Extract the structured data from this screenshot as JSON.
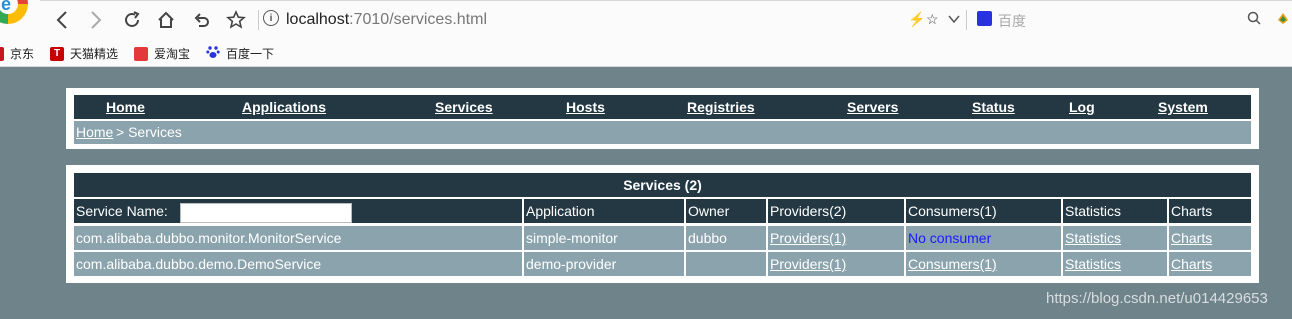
{
  "browser": {
    "url_host": "localhost",
    "url_rest": ":7010/services.html",
    "search_placeholder": "百度"
  },
  "bookmarks": [
    {
      "label": "京东",
      "icon": "jd-icon",
      "color": "#c81623"
    },
    {
      "label": "天猫精选",
      "icon": "tmall-icon",
      "color": "#c40000"
    },
    {
      "label": "爱淘宝",
      "icon": "aitaobao-icon",
      "color": "#e4393c"
    },
    {
      "label": "百度一下",
      "icon": "baidu-paw-icon",
      "color": "#2932e1"
    }
  ],
  "nav": {
    "items": [
      "Home",
      "Applications",
      "Services",
      "Hosts",
      "Registries",
      "Servers",
      "Status",
      "Log",
      "System"
    ]
  },
  "breadcrumb": {
    "home": "Home",
    "rest": "> Services"
  },
  "services": {
    "caption": "Services (2)",
    "search_label": "Service Name:",
    "search_value": "",
    "headers": [
      "Application",
      "Owner",
      "Providers(2)",
      "Consumers(1)",
      "Statistics",
      "Charts"
    ],
    "rows": [
      {
        "service": "com.alibaba.dubbo.monitor.MonitorService",
        "application": "simple-monitor",
        "owner": "dubbo",
        "providers": "Providers(1)",
        "consumers": "No consumer",
        "statistics": "Statistics",
        "charts": "Charts"
      },
      {
        "service": "com.alibaba.dubbo.demo.DemoService",
        "application": "demo-provider",
        "owner": "",
        "providers": "Providers(1)",
        "consumers": "Consumers(1)",
        "statistics": "Statistics",
        "charts": "Charts"
      }
    ]
  },
  "watermark": "https://blog.csdn.net/u014429653",
  "colors": {
    "page_bg": "#6f838b",
    "header_bg": "#233843",
    "row_bg": "#8aa3ad",
    "no_consumer": "#1a1aff"
  }
}
